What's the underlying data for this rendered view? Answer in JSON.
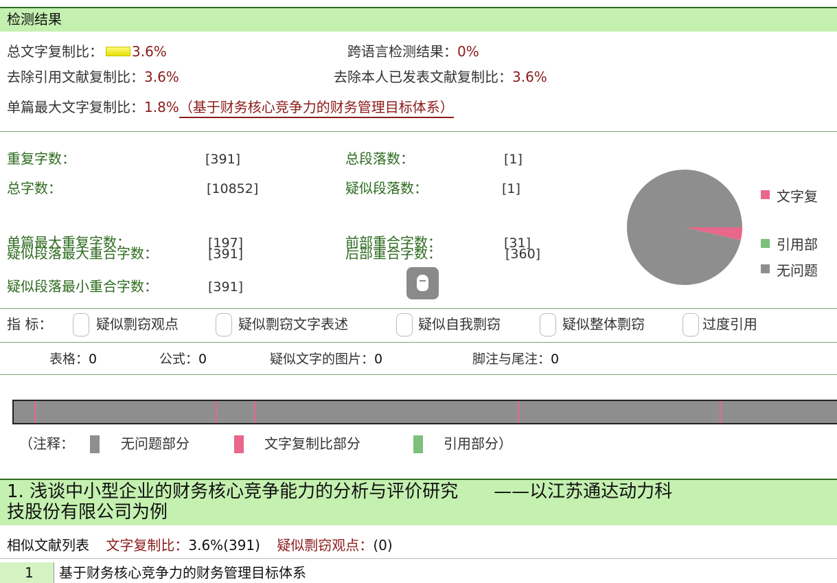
{
  "header": {
    "title": "检测结果"
  },
  "summary": {
    "total_copy_label": "总文字复制比：",
    "total_copy_value": "3.6%",
    "cross_lang_label": "跨语言检测结果：",
    "cross_lang_value": "0%",
    "excl_ref_label": "去除引用文献复制比：",
    "excl_ref_value": "3.6%",
    "excl_self_label": "去除本人已发表文献复制比：",
    "excl_self_value": "3.6%",
    "max_single_label": "单篇最大文字复制比：",
    "max_single_value": "1.8%",
    "max_single_source": "（基于财务核心竞争力的财务管理目标体系）"
  },
  "stats": {
    "dup_chars_label": "重复字数：",
    "dup_chars_value": "[391]",
    "total_paras_label": "总段落数：",
    "total_paras_value": "[1]",
    "total_chars_label": "总字数：",
    "total_chars_value": "[10852]",
    "susp_paras_label": "疑似段落数：",
    "susp_paras_value": "[1]",
    "max_single_dup_label": "单篇最大重复字数：",
    "max_single_dup_value": "[197]",
    "front_overlap_label": "前部重合字数：",
    "front_overlap_value": "[31]",
    "susp_max_label": "疑似段落最大重合字数：",
    "susp_max_value": "[391]",
    "back_overlap_label": "后部重合字数：",
    "back_overlap_value": "[360]",
    "susp_min_label": "疑似段落最小重合字数：",
    "susp_min_value": "[391]"
  },
  "pie": {
    "legend": [
      "文字复",
      "引用部",
      "无问题"
    ],
    "colors": [
      "#e8678a",
      "#7cc07c",
      "#8e8e8e"
    ],
    "values": [
      3.6,
      0,
      96.4
    ]
  },
  "indicators": {
    "label": "指 标：",
    "items": [
      "疑似剽窃观点",
      "疑似剽窃文字表述",
      "疑似自我剽窃",
      "疑似整体剽窃",
      "过度引用"
    ]
  },
  "counts": {
    "table_label": "表格：",
    "table_value": "0",
    "formula_label": "公式：",
    "formula_value": "0",
    "image_label": "疑似文字的图片：",
    "image_value": "0",
    "footnote_label": "脚注与尾注：",
    "footnote_value": "0"
  },
  "strip": {
    "marks": [
      0.025,
      0.245,
      0.292,
      0.612,
      0.857
    ]
  },
  "note": {
    "open": "（注释：",
    "ok": "无问题部分",
    "copy": "文字复制比部分",
    "cite": "引用部分）",
    "colors": {
      "ok": "#8e8e8e",
      "copy": "#e8678a",
      "cite": "#7cc07c"
    }
  },
  "section": {
    "title_line1": "1. 浅谈中小型企业的财务核心竞争能力的分析与评价研究　　——以江苏通达动力科",
    "title_line2": "技股份有限公司为例",
    "list_label": "相似文献列表",
    "copy_label": "文字复制比：",
    "copy_value": "3.6%(391)",
    "plag_label": "疑似剽窃观点：",
    "plag_value": "(0)"
  },
  "list": [
    {
      "num": "1",
      "title": "基于财务核心竞争力的财务管理目标体系"
    }
  ]
}
